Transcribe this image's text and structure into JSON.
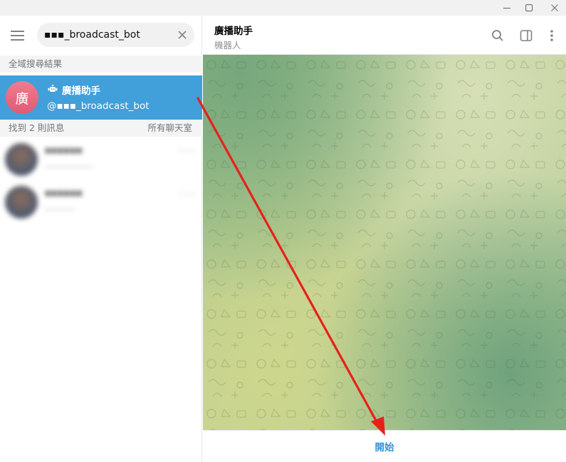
{
  "window": {
    "controls": [
      "minimize-icon",
      "maximize-icon",
      "close-icon"
    ]
  },
  "sidebar": {
    "menu_icon": "hamburger-icon",
    "search": {
      "value": "▪▪▪_broadcast_bot",
      "clear_icon": "close-icon"
    },
    "global_results_label": "全域搜尋結果",
    "result": {
      "avatar_letter": "廣",
      "name": "廣播助手",
      "handle": "@▪▪▪_broadcast_bot",
      "bot_icon": "bot-icon"
    },
    "messages_label": "找到 2 則訊息",
    "messages_scope": "所有聊天室",
    "messages": [
      {
        "name": "▪▪▪▪▪▪",
        "time": "– – –",
        "preview": "–––––––––––"
      },
      {
        "name": "▪▪▪▪▪▪",
        "time": "– – –",
        "preview": "–––––––"
      }
    ]
  },
  "chat": {
    "title": "廣播助手",
    "subtitle": "機器人",
    "header_icons": [
      "search-icon",
      "sidebar-panel-icon",
      "more-vertical-icon"
    ],
    "start_label": "開始"
  },
  "colors": {
    "accent": "#419fd9",
    "start": "#3a8fd0",
    "annotation_arrow": "#e8201a"
  }
}
